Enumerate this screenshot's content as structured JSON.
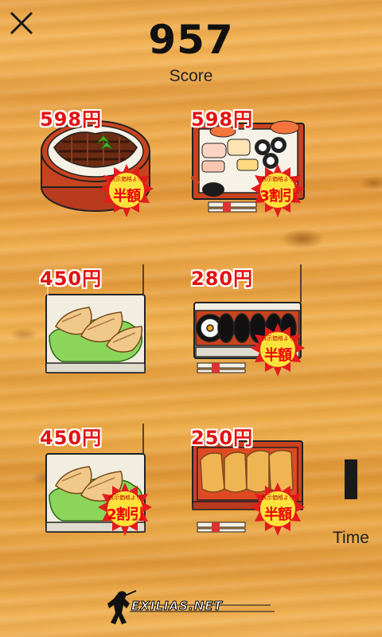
{
  "score": {
    "value": "957",
    "label": "Score"
  },
  "time": {
    "label": "Time",
    "remaining_fraction": 0.28
  },
  "items": [
    {
      "name": "unagi-bento",
      "price": "598円",
      "badge_small": "表示価格より",
      "badge_big": "半額"
    },
    {
      "name": "sushi-bento",
      "price": "598円",
      "badge_small": "表示価格より",
      "badge_big": "3割引"
    },
    {
      "name": "gyoza-pack",
      "price": "450円",
      "badge_small": "",
      "badge_big": ""
    },
    {
      "name": "maki-roll-pack",
      "price": "280円",
      "badge_small": "表示価格より",
      "badge_big": "半額"
    },
    {
      "name": "gyoza-pack",
      "price": "450円",
      "badge_small": "表示価格より",
      "badge_big": "2割引"
    },
    {
      "name": "inari-pack",
      "price": "250円",
      "badge_small": "表示価格より",
      "badge_big": "半額"
    }
  ],
  "logo": {
    "text": "EXILIAS.NET"
  },
  "colors": {
    "price_red": "#e31313",
    "badge_yellow": "#ffe23a",
    "badge_red": "#e31c1c"
  },
  "icons": {
    "close": "close-icon"
  }
}
